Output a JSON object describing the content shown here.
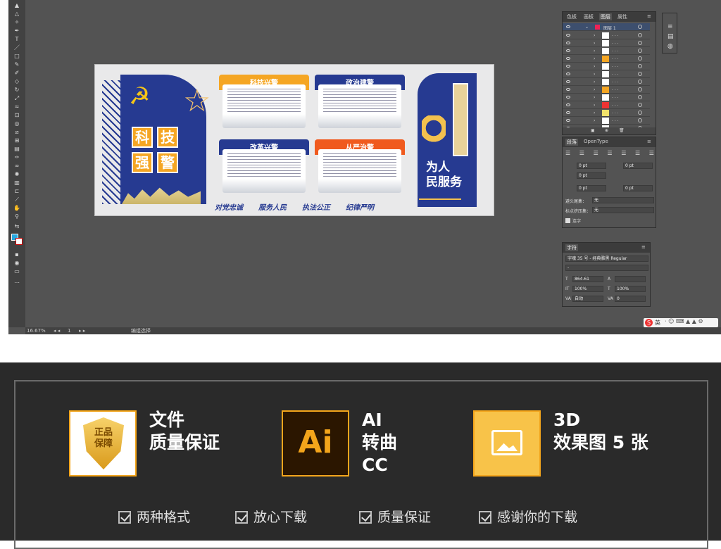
{
  "app": {
    "panels": {
      "layers": {
        "tabs": [
          "色板",
          "画板",
          "图层",
          "属性"
        ],
        "active_tab": "图层",
        "layer_name": "图层 1",
        "sublayer_colors": [
          "#ffffff",
          "#ffffff",
          "#ffffff",
          "#f5a623",
          "#ffffff",
          "#ffffff",
          "#ffffff",
          "#f5a623",
          "#ffffff",
          "#e33",
          "#f1e26b",
          "#ffffff",
          "#ffffff"
        ]
      },
      "paragraph": {
        "tabs": [
          "段落",
          "OpenType"
        ],
        "active_tab": "段落",
        "indent_left": "0 pt",
        "indent_right": "0 pt",
        "first_indent": "0 pt",
        "space_before": "0 pt",
        "space_after": "0 pt",
        "kinsoku_label": "避头尾集：",
        "kinsoku_value": "无",
        "mojikumi_label": "标点挤压集：",
        "mojikumi_value": "无",
        "hyphenate_label": "连字"
      },
      "character": {
        "tab": "字符",
        "font": "字魂 35 号 - 经典雅黑 Regular",
        "style": "-",
        "size": "864.61",
        "tracking": "",
        "vscale": "100%",
        "hscale": "100%",
        "leading": "自动",
        "kerning": "0"
      }
    },
    "status": {
      "zoom": "16.67%",
      "artboard": "1",
      "mode": "编组选择"
    },
    "ime": {
      "label": "英"
    }
  },
  "artwork": {
    "big_chars": [
      "科",
      "技",
      "强",
      "警"
    ],
    "cards": [
      {
        "title": "科技兴警",
        "color": "#f5a623"
      },
      {
        "title": "政治建警",
        "color": "#263a91"
      },
      {
        "title": "改革兴警",
        "color": "#263a91"
      },
      {
        "title": "从严治警",
        "color": "#f05a1e"
      }
    ],
    "right_slogan": [
      "为人",
      "民服务"
    ],
    "slogans": [
      "对党忠诚",
      "服务人民",
      "执法公正",
      "纪律严明"
    ]
  },
  "promo": {
    "items": [
      {
        "badge_text": [
          "正品",
          "保障"
        ],
        "title": [
          "文件",
          "质量保证"
        ]
      },
      {
        "badge_text": [
          "Ai"
        ],
        "title": [
          "AI",
          "转曲",
          "CC"
        ]
      },
      {
        "badge_text": [
          ""
        ],
        "title": [
          "3D",
          "效果图 5 张"
        ]
      }
    ],
    "checks": [
      "两种格式",
      "放心下载",
      "质量保证",
      "感谢你的下载"
    ],
    "accent": "#f3a51b"
  }
}
